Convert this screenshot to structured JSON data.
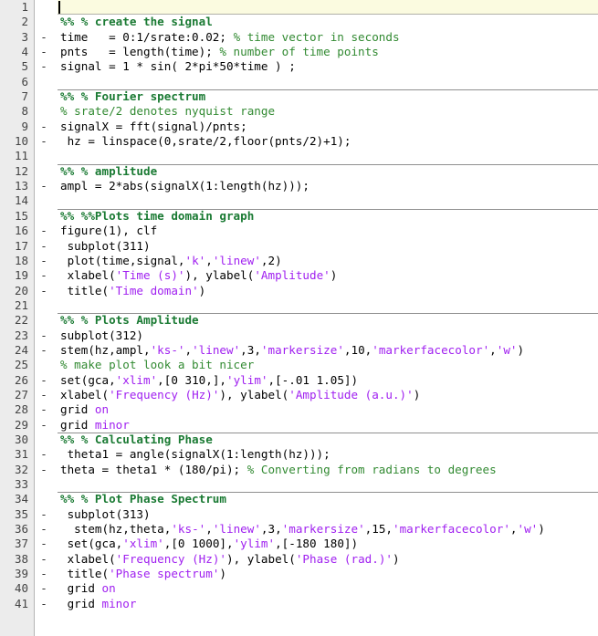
{
  "app": {
    "name": "MATLAB Editor",
    "view": "code-editor",
    "language": "MATLAB"
  },
  "colors": {
    "background": "#ffffff",
    "gutter_background": "#ececec",
    "gutter_border": "#b4b4b4",
    "current_line_highlight": "#fbfbe0",
    "current_line_border": "#b0b0a8",
    "section_divider": "#8f8f8f",
    "comment": "#328a32",
    "cell_title": "#1a7a33",
    "string": "#a020f0",
    "plain_text": "#000000",
    "line_number": "#444444",
    "caret": "#000000"
  },
  "editor": {
    "total_lines": 41,
    "first_visible_line": 1,
    "last_visible_line": 41,
    "caret_line": 1,
    "caret_column": 1
  },
  "lines": [
    {
      "number": "1",
      "mark": "",
      "section": false,
      "current": true,
      "tokens": []
    },
    {
      "number": "2",
      "mark": "",
      "section": false,
      "current": false,
      "tokens": [
        {
          "t": "cell",
          "s": "%% % create the signal"
        }
      ]
    },
    {
      "number": "3",
      "mark": "-",
      "section": false,
      "current": false,
      "tokens": [
        {
          "t": "plain",
          "s": "time   = 0:1/srate:0.02; "
        },
        {
          "t": "comment",
          "s": "% time vector in seconds"
        }
      ]
    },
    {
      "number": "4",
      "mark": "-",
      "section": false,
      "current": false,
      "tokens": [
        {
          "t": "plain",
          "s": "pnts   = length(time); "
        },
        {
          "t": "comment",
          "s": "% number of time points"
        }
      ]
    },
    {
      "number": "5",
      "mark": "-",
      "section": false,
      "current": false,
      "tokens": [
        {
          "t": "plain",
          "s": "signal = 1 * sin( 2*pi*50*time ) ;"
        }
      ]
    },
    {
      "number": "6",
      "mark": "",
      "section": false,
      "current": false,
      "tokens": []
    },
    {
      "number": "7",
      "mark": "",
      "section": true,
      "current": false,
      "tokens": [
        {
          "t": "cell",
          "s": "%% % Fourier spectrum"
        }
      ]
    },
    {
      "number": "8",
      "mark": "",
      "section": false,
      "current": false,
      "tokens": [
        {
          "t": "comment",
          "s": "% srate/2 denotes nyquist range"
        }
      ]
    },
    {
      "number": "9",
      "mark": "-",
      "section": false,
      "current": false,
      "tokens": [
        {
          "t": "plain",
          "s": "signalX = fft(signal)/pnts;"
        }
      ]
    },
    {
      "number": "10",
      "mark": "-",
      "section": false,
      "current": false,
      "tokens": [
        {
          "t": "plain",
          "s": " hz = linspace(0,srate/2,floor(pnts/2)+1);"
        }
      ]
    },
    {
      "number": "11",
      "mark": "",
      "section": false,
      "current": false,
      "tokens": []
    },
    {
      "number": "12",
      "mark": "",
      "section": true,
      "current": false,
      "tokens": [
        {
          "t": "cell",
          "s": "%% % amplitude"
        }
      ]
    },
    {
      "number": "13",
      "mark": "-",
      "section": false,
      "current": false,
      "tokens": [
        {
          "t": "plain",
          "s": "ampl = 2*abs(signalX(1:length(hz)));"
        }
      ]
    },
    {
      "number": "14",
      "mark": "",
      "section": false,
      "current": false,
      "tokens": []
    },
    {
      "number": "15",
      "mark": "",
      "section": true,
      "current": false,
      "tokens": [
        {
          "t": "cell",
          "s": "%% %%Plots time domain graph"
        }
      ]
    },
    {
      "number": "16",
      "mark": "-",
      "section": false,
      "current": false,
      "tokens": [
        {
          "t": "plain",
          "s": "figure(1), clf"
        }
      ]
    },
    {
      "number": "17",
      "mark": "-",
      "section": false,
      "current": false,
      "tokens": [
        {
          "t": "plain",
          "s": " subplot(311)"
        }
      ]
    },
    {
      "number": "18",
      "mark": "-",
      "section": false,
      "current": false,
      "tokens": [
        {
          "t": "plain",
          "s": " plot(time,signal,"
        },
        {
          "t": "string",
          "s": "'k'"
        },
        {
          "t": "plain",
          "s": ","
        },
        {
          "t": "string",
          "s": "'linew'"
        },
        {
          "t": "plain",
          "s": ",2)"
        }
      ]
    },
    {
      "number": "19",
      "mark": "-",
      "section": false,
      "current": false,
      "tokens": [
        {
          "t": "plain",
          "s": " xlabel("
        },
        {
          "t": "string",
          "s": "'Time (s)'"
        },
        {
          "t": "plain",
          "s": "), ylabel("
        },
        {
          "t": "string",
          "s": "'Amplitude'"
        },
        {
          "t": "plain",
          "s": ")"
        }
      ]
    },
    {
      "number": "20",
      "mark": "-",
      "section": false,
      "current": false,
      "tokens": [
        {
          "t": "plain",
          "s": " title("
        },
        {
          "t": "string",
          "s": "'Time domain'"
        },
        {
          "t": "plain",
          "s": ")"
        }
      ]
    },
    {
      "number": "21",
      "mark": "",
      "section": false,
      "current": false,
      "tokens": []
    },
    {
      "number": "22",
      "mark": "",
      "section": true,
      "current": false,
      "tokens": [
        {
          "t": "cell",
          "s": "%% % Plots Amplitude"
        }
      ]
    },
    {
      "number": "23",
      "mark": "-",
      "section": false,
      "current": false,
      "tokens": [
        {
          "t": "plain",
          "s": "subplot(312)"
        }
      ]
    },
    {
      "number": "24",
      "mark": "-",
      "section": false,
      "current": false,
      "tokens": [
        {
          "t": "plain",
          "s": "stem(hz,ampl,"
        },
        {
          "t": "string",
          "s": "'ks-'"
        },
        {
          "t": "plain",
          "s": ","
        },
        {
          "t": "string",
          "s": "'linew'"
        },
        {
          "t": "plain",
          "s": ",3,"
        },
        {
          "t": "string",
          "s": "'markersize'"
        },
        {
          "t": "plain",
          "s": ",10,"
        },
        {
          "t": "string",
          "s": "'markerfacecolor'"
        },
        {
          "t": "plain",
          "s": ","
        },
        {
          "t": "string",
          "s": "'w'"
        },
        {
          "t": "plain",
          "s": ")"
        }
      ]
    },
    {
      "number": "25",
      "mark": "",
      "section": false,
      "current": false,
      "tokens": [
        {
          "t": "comment",
          "s": "% make plot look a bit nicer"
        }
      ]
    },
    {
      "number": "26",
      "mark": "-",
      "section": false,
      "current": false,
      "tokens": [
        {
          "t": "plain",
          "s": "set(gca,"
        },
        {
          "t": "string",
          "s": "'xlim'"
        },
        {
          "t": "plain",
          "s": ",[0 310,],"
        },
        {
          "t": "string",
          "s": "'ylim'"
        },
        {
          "t": "plain",
          "s": ",[-.01 1.05])"
        }
      ]
    },
    {
      "number": "27",
      "mark": "-",
      "section": false,
      "current": false,
      "tokens": [
        {
          "t": "plain",
          "s": "xlabel("
        },
        {
          "t": "string",
          "s": "'Frequency (Hz)'"
        },
        {
          "t": "plain",
          "s": "), ylabel("
        },
        {
          "t": "string",
          "s": "'Amplitude (a.u.)'"
        },
        {
          "t": "plain",
          "s": ")"
        }
      ]
    },
    {
      "number": "28",
      "mark": "-",
      "section": false,
      "current": false,
      "tokens": [
        {
          "t": "plain",
          "s": "grid "
        },
        {
          "t": "option",
          "s": "on"
        }
      ]
    },
    {
      "number": "29",
      "mark": "-",
      "section": false,
      "current": false,
      "tokens": [
        {
          "t": "plain",
          "s": "grid "
        },
        {
          "t": "option",
          "s": "minor"
        }
      ]
    },
    {
      "number": "30",
      "mark": "",
      "section": true,
      "current": false,
      "tokens": [
        {
          "t": "cell",
          "s": "%% % Calculating Phase"
        }
      ]
    },
    {
      "number": "31",
      "mark": "-",
      "section": false,
      "current": false,
      "tokens": [
        {
          "t": "plain",
          "s": " theta1 = angle(signalX(1:length(hz)));"
        }
      ]
    },
    {
      "number": "32",
      "mark": "-",
      "section": false,
      "current": false,
      "tokens": [
        {
          "t": "plain",
          "s": "theta = theta1 * (180/pi); "
        },
        {
          "t": "comment",
          "s": "% Converting from radians to degrees"
        }
      ]
    },
    {
      "number": "33",
      "mark": "",
      "section": false,
      "current": false,
      "tokens": []
    },
    {
      "number": "34",
      "mark": "",
      "section": true,
      "current": false,
      "tokens": [
        {
          "t": "cell",
          "s": "%% % Plot Phase Spectrum"
        }
      ]
    },
    {
      "number": "35",
      "mark": "-",
      "section": false,
      "current": false,
      "tokens": [
        {
          "t": "plain",
          "s": " subplot(313)"
        }
      ]
    },
    {
      "number": "36",
      "mark": "-",
      "section": false,
      "current": false,
      "tokens": [
        {
          "t": "plain",
          "s": "  stem(hz,theta,"
        },
        {
          "t": "string",
          "s": "'ks-'"
        },
        {
          "t": "plain",
          "s": ","
        },
        {
          "t": "string",
          "s": "'linew'"
        },
        {
          "t": "plain",
          "s": ",3,"
        },
        {
          "t": "string",
          "s": "'markersize'"
        },
        {
          "t": "plain",
          "s": ",15,"
        },
        {
          "t": "string",
          "s": "'markerfacecolor'"
        },
        {
          "t": "plain",
          "s": ","
        },
        {
          "t": "string",
          "s": "'w'"
        },
        {
          "t": "plain",
          "s": ")"
        }
      ]
    },
    {
      "number": "37",
      "mark": "-",
      "section": false,
      "current": false,
      "tokens": [
        {
          "t": "plain",
          "s": " set(gca,"
        },
        {
          "t": "string",
          "s": "'xlim'"
        },
        {
          "t": "plain",
          "s": ",[0 1000],"
        },
        {
          "t": "string",
          "s": "'ylim'"
        },
        {
          "t": "plain",
          "s": ",[-180 180])"
        }
      ]
    },
    {
      "number": "38",
      "mark": "-",
      "section": false,
      "current": false,
      "tokens": [
        {
          "t": "plain",
          "s": " xlabel("
        },
        {
          "t": "string",
          "s": "'Frequency (Hz)'"
        },
        {
          "t": "plain",
          "s": "), ylabel("
        },
        {
          "t": "string",
          "s": "'Phase (rad.)'"
        },
        {
          "t": "plain",
          "s": ")"
        }
      ]
    },
    {
      "number": "39",
      "mark": "-",
      "section": false,
      "current": false,
      "tokens": [
        {
          "t": "plain",
          "s": " title("
        },
        {
          "t": "string",
          "s": "'Phase spectrum'"
        },
        {
          "t": "plain",
          "s": ")"
        }
      ]
    },
    {
      "number": "40",
      "mark": "-",
      "section": false,
      "current": false,
      "tokens": [
        {
          "t": "plain",
          "s": " grid "
        },
        {
          "t": "option",
          "s": "on"
        }
      ]
    },
    {
      "number": "41",
      "mark": "-",
      "section": false,
      "current": false,
      "tokens": [
        {
          "t": "plain",
          "s": " grid "
        },
        {
          "t": "option",
          "s": "minor"
        }
      ]
    }
  ]
}
